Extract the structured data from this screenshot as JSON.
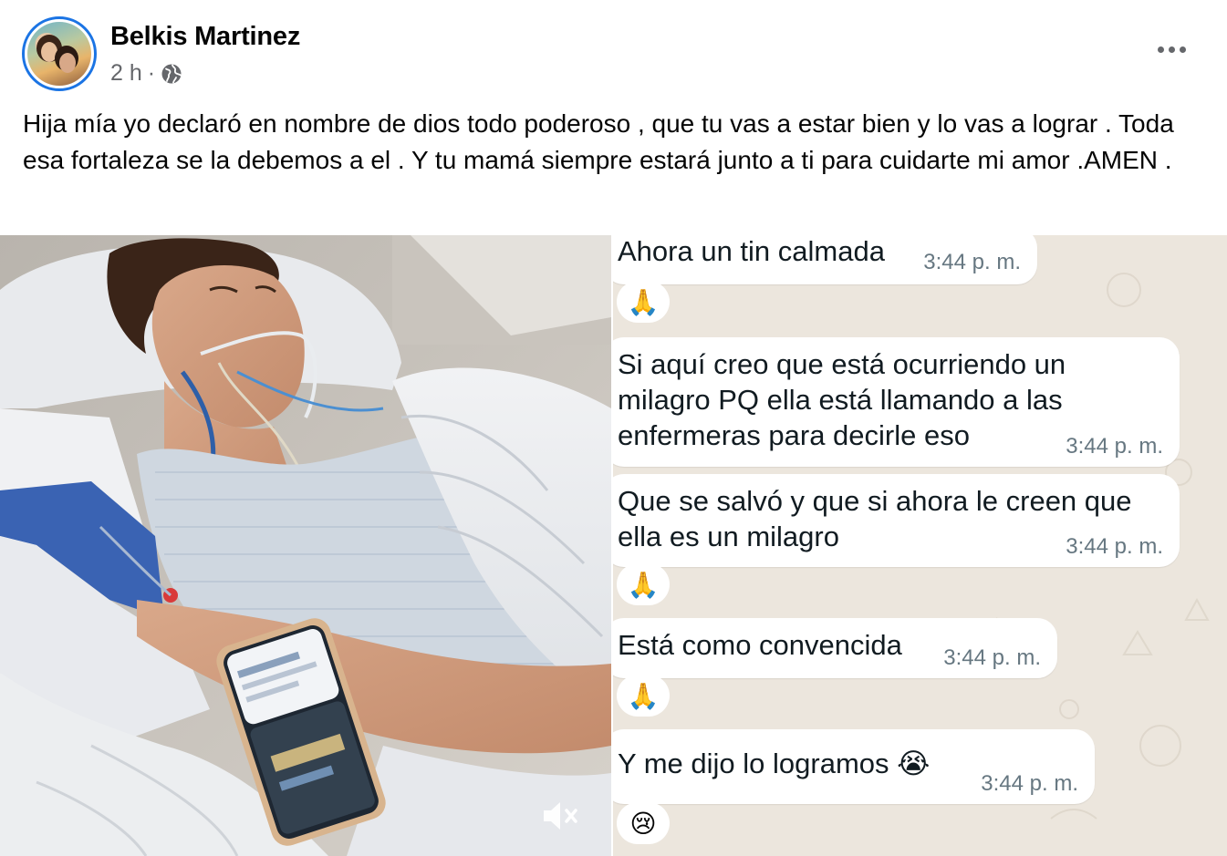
{
  "post": {
    "author": "Belkis Martinez",
    "time": "2 h",
    "separator": "·",
    "audience_icon": "globe-icon",
    "more_icon": "more-options-icon",
    "caption": "Hija mía yo declaró en nombre de dios todo poderoso , que tu vas a estar bien y lo vas a lograr . Toda esa fortaleza se la debemos a el . Y tu mamá siempre estará junto a ti para cuidarte mi amor .AMEN ."
  },
  "media": {
    "photo_icon": "hospital-photo",
    "mute_icon": "speaker-muted-icon",
    "chat": {
      "messages": [
        {
          "text": "Ahora un tin calmada",
          "time": "3:44 p. m.",
          "reaction": "🙏"
        },
        {
          "text": "Si aquí creo que está ocurriendo un\nmilagro PQ ella está llamando a las\nenfermeras para decirle eso",
          "time": "3:44 p. m.",
          "reaction": ""
        },
        {
          "text": "Que se salvó y que si ahora le creen que\nella es un milagro",
          "time": "3:44 p. m.",
          "reaction": "🙏"
        },
        {
          "text": "Está como convencida",
          "time": "3:44 p. m.",
          "reaction": "🙏"
        },
        {
          "text": "Y me dijo lo logramos 😭",
          "time": "3:44 p. m.",
          "reaction": "😢"
        }
      ]
    }
  },
  "colors": {
    "accent": "#1b74e4",
    "secondary_text": "#65676b",
    "chat_background": "#ece6dd",
    "bubble": "#ffffff"
  }
}
